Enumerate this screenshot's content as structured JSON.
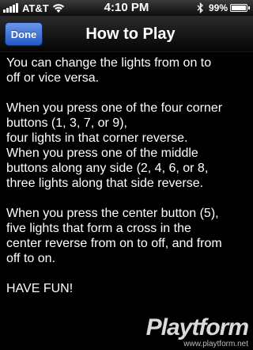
{
  "status_bar": {
    "carrier": "AT&T",
    "time": "4:10 PM",
    "battery_percent": "99%",
    "battery_level": 0.99,
    "icons": [
      "signal-icon",
      "wifi-icon",
      "bluetooth-icon",
      "battery-icon"
    ]
  },
  "nav_bar": {
    "done_label": "Done",
    "title": "How to Play",
    "done_color": "#3a72d8"
  },
  "content": {
    "paragraphs": [
      {
        "lines": [
          "You can change the lights from on to",
          "off or vice versa."
        ]
      },
      {
        "lines": [
          "When you press one of the four corner",
          "buttons (1, 3, 7, or 9),",
          "four lights in that corner reverse.",
          "When you press one of the middle",
          "buttons along any side (2, 4, 6, or 8,",
          "three lights along that side reverse."
        ]
      },
      {
        "lines": [
          "When you press the center button (5),",
          "five lights that form a cross in the",
          "center reverse from on to off, and from",
          "off to on."
        ]
      },
      {
        "lines": [
          "HAVE FUN!"
        ]
      }
    ]
  },
  "watermark": {
    "logo": "Playtform",
    "url": "www.playtform.net"
  }
}
